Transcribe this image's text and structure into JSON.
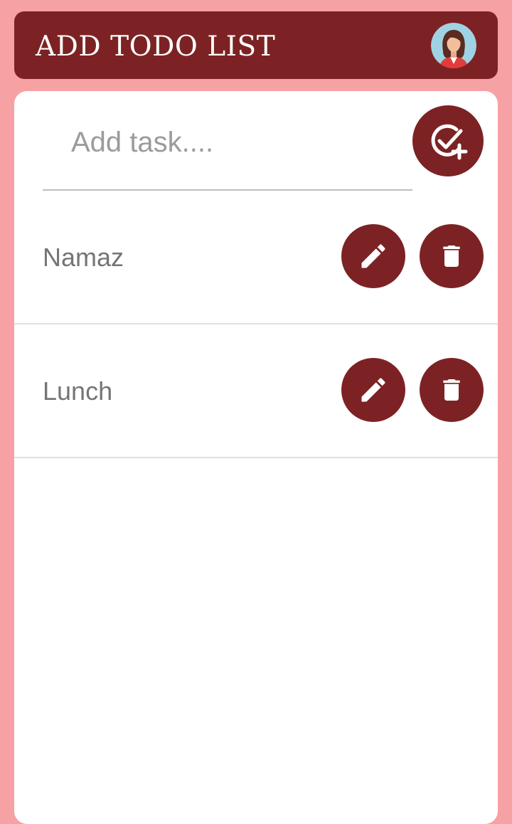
{
  "header": {
    "title": "ADD TODO LIST",
    "avatar_icon": "woman-avatar-icon"
  },
  "input": {
    "placeholder": "Add task....",
    "value": "",
    "add_button_icon": "check-circle-plus-icon"
  },
  "tasks": [
    {
      "label": "Namaz",
      "edit_icon": "pencil-icon",
      "delete_icon": "trash-icon"
    },
    {
      "label": "Lunch",
      "edit_icon": "pencil-icon",
      "delete_icon": "trash-icon"
    }
  ],
  "colors": {
    "background": "#f6a1a3",
    "accent": "#7d2224",
    "card": "#ffffff",
    "task_text": "#757575"
  }
}
